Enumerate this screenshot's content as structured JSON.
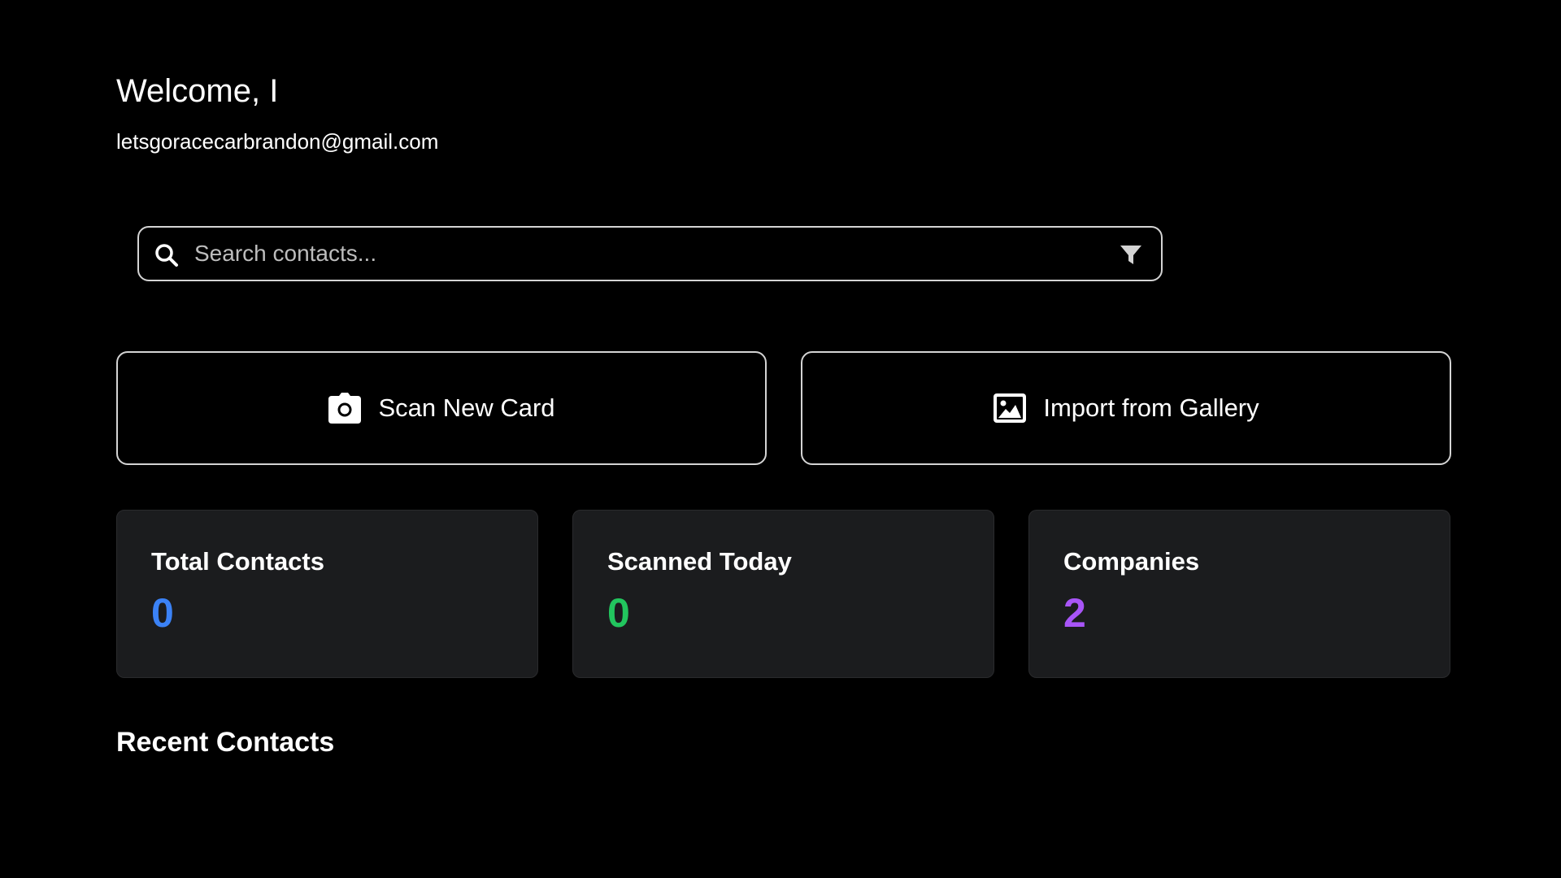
{
  "header": {
    "welcome": "Welcome, I",
    "email": "letsgoracecarbrandon@gmail.com"
  },
  "search": {
    "placeholder": "Search contacts...",
    "value": "",
    "search_icon": "search-icon",
    "filter_icon": "filter-icon"
  },
  "actions": {
    "scan": {
      "label": "Scan New Card",
      "icon": "camera-icon"
    },
    "gallery": {
      "label": "Import from Gallery",
      "icon": "image-icon"
    }
  },
  "stats": [
    {
      "label": "Total Contacts",
      "value": "0",
      "color": "#3b82f6"
    },
    {
      "label": "Scanned Today",
      "value": "0",
      "color": "#22c55e"
    },
    {
      "label": "Companies",
      "value": "2",
      "color": "#a855f7"
    }
  ],
  "recent": {
    "title": "Recent Contacts"
  },
  "theme": {
    "background": "#000000",
    "card_background": "#1b1c1e",
    "border": "#d4d4d4"
  }
}
